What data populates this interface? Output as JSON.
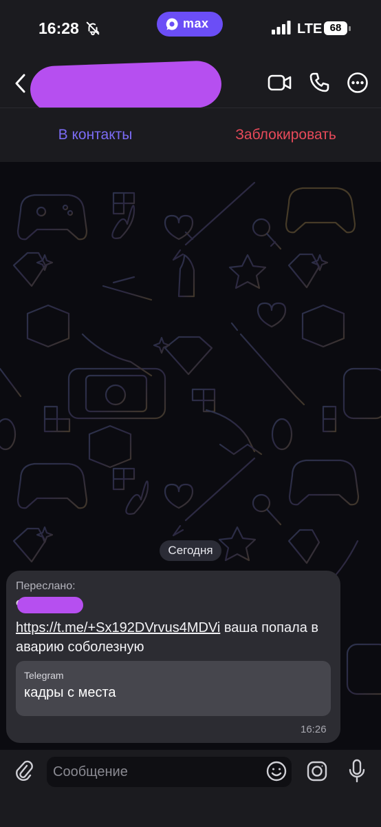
{
  "status_bar": {
    "time": "16:28",
    "app_name": "max",
    "network": "LTE",
    "battery": "68",
    "icons": [
      "bell-slash-icon",
      "max-logo-icon",
      "signal-icon",
      "battery-icon"
    ]
  },
  "header": {
    "icons": [
      "chevron-left-icon",
      "video-camera-icon",
      "phone-icon",
      "more-icon"
    ]
  },
  "actions": {
    "add_contact": "В контакты",
    "block": "Заблокировать"
  },
  "chat": {
    "date_separator": "Сегодня",
    "message": {
      "forwarded_label": "Переслано:",
      "link": "https://t.me/+Sx192DVrvus4MDVi",
      "text": "ваша попала в аварию соболезную",
      "preview": {
        "source": "Telegram",
        "title": "кадры с места"
      },
      "time": "16:26"
    }
  },
  "composer": {
    "placeholder": "Сообщение",
    "icons": [
      "paperclip-icon",
      "emoji-icon",
      "camera-icon",
      "microphone-icon"
    ]
  },
  "colors": {
    "accent": "#7c6cf6",
    "danger": "#e84a5a",
    "app_pill": "#6b4ef6",
    "redaction": "#b64ff0"
  }
}
